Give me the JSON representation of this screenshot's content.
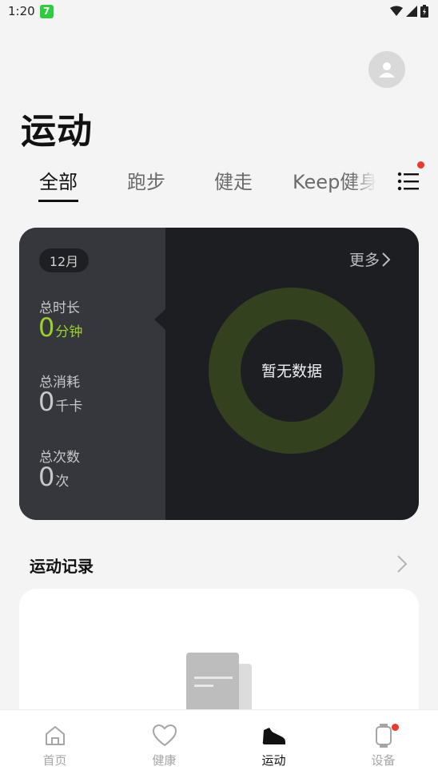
{
  "status_bar": {
    "time": "1:20",
    "badge": "7"
  },
  "header": {
    "title": "运动"
  },
  "tabs": [
    {
      "label": "全部",
      "active": true
    },
    {
      "label": "跑步",
      "active": false
    },
    {
      "label": "健走",
      "active": false
    },
    {
      "label": "Keep健身",
      "active": false
    }
  ],
  "stats": {
    "month": "12月",
    "more": "更多",
    "duration": {
      "label": "总时长",
      "value": "0",
      "unit": "分钟"
    },
    "calories": {
      "label": "总消耗",
      "value": "0",
      "unit": "千卡"
    },
    "count": {
      "label": "总次数",
      "value": "0",
      "unit": "次"
    },
    "no_data": "暂无数据"
  },
  "records": {
    "title": "运动记录"
  },
  "nav": {
    "items": [
      {
        "label": "首页",
        "icon": "home-icon",
        "active": false
      },
      {
        "label": "健康",
        "icon": "heart-icon",
        "active": false
      },
      {
        "label": "运动",
        "icon": "shoe-icon",
        "active": true
      },
      {
        "label": "设备",
        "icon": "watch-icon",
        "active": false
      }
    ]
  },
  "colors": {
    "accent": "#9ad12c",
    "card_dark": "#1d1e22",
    "card_panel": "#35373c",
    "donut": "#33411f",
    "notification": "#ea3a30"
  }
}
